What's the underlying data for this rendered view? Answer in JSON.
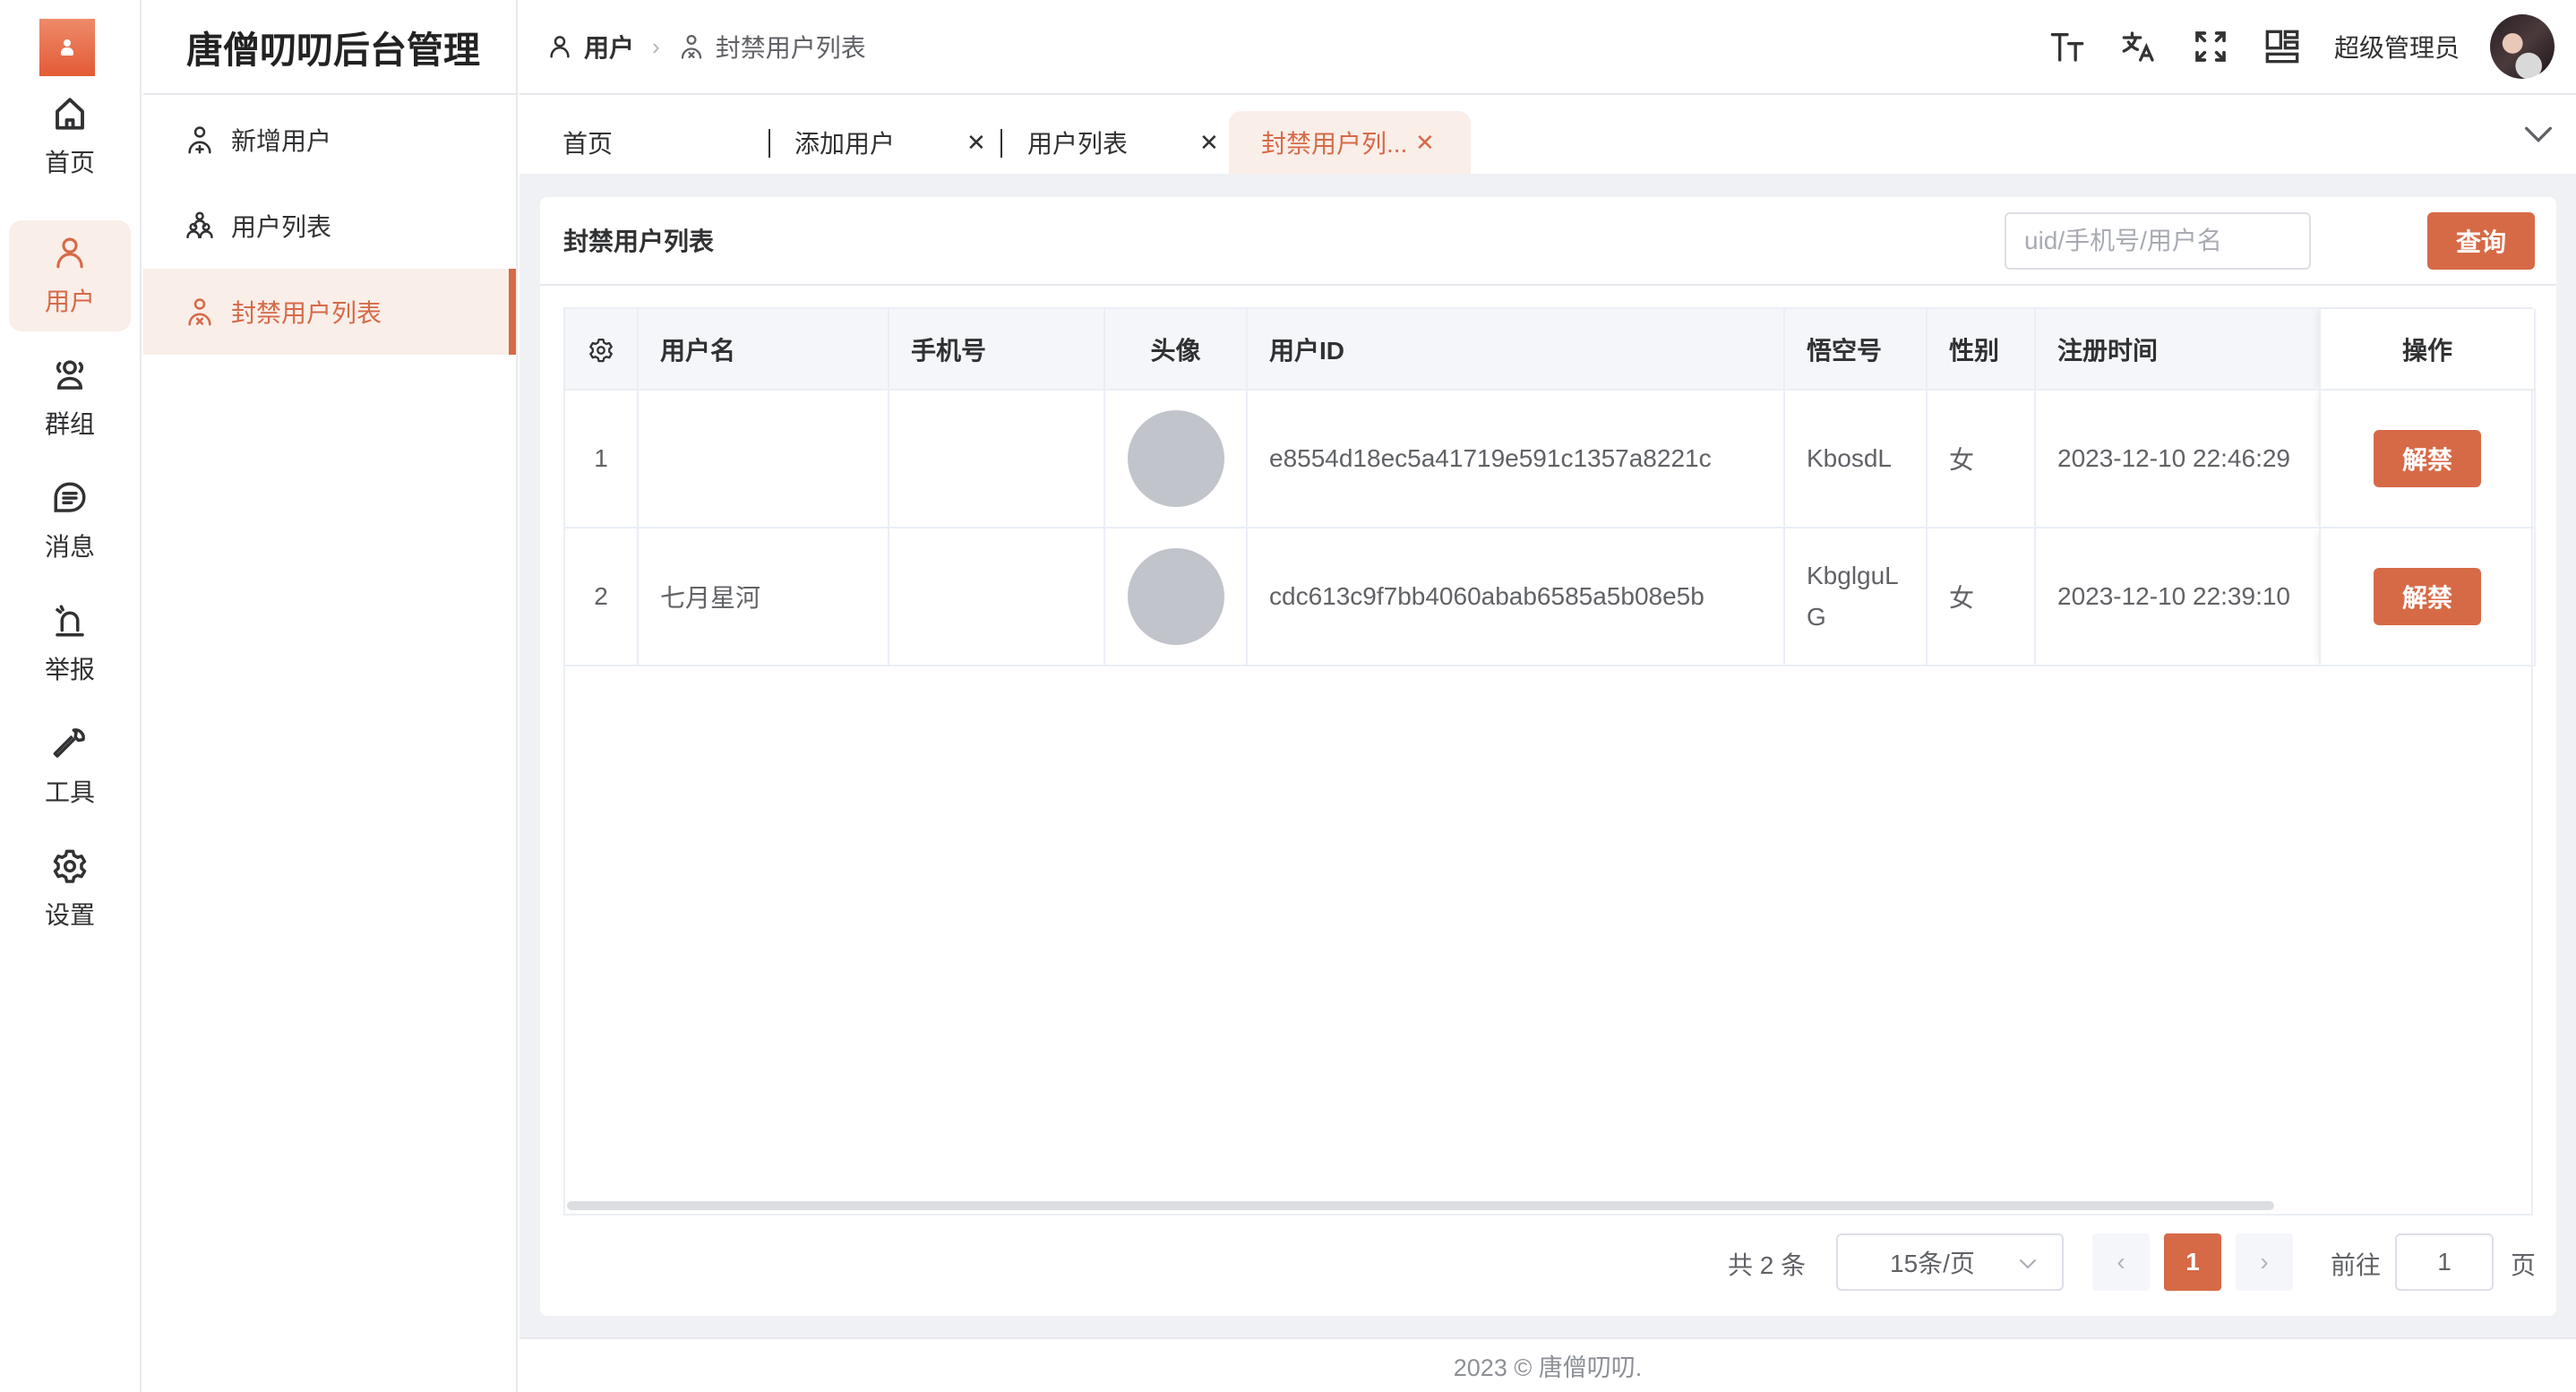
{
  "app": {
    "title": "唐僧叨叨后台管理"
  },
  "rail": {
    "items": [
      {
        "label": "首页",
        "icon": "home-icon"
      },
      {
        "label": "用户",
        "icon": "user-icon",
        "active": true
      },
      {
        "label": "群组",
        "icon": "group-icon"
      },
      {
        "label": "消息",
        "icon": "message-icon"
      },
      {
        "label": "举报",
        "icon": "alarm-icon"
      },
      {
        "label": "工具",
        "icon": "wrench-icon"
      },
      {
        "label": "设置",
        "icon": "gear-icon"
      }
    ]
  },
  "submenu": {
    "items": [
      {
        "label": "新增用户",
        "icon": "user-add-icon"
      },
      {
        "label": "用户列表",
        "icon": "users-icon"
      },
      {
        "label": "封禁用户列表",
        "icon": "user-banned-icon",
        "active": true
      }
    ]
  },
  "breadcrumb": {
    "parent": "用户",
    "current": "封禁用户列表"
  },
  "header": {
    "admin_name": "超级管理员"
  },
  "tabs": [
    {
      "label": "首页",
      "closable": false
    },
    {
      "label": "添加用户",
      "closable": true
    },
    {
      "label": "用户列表",
      "closable": true
    },
    {
      "label": "封禁用户列...",
      "closable": true,
      "active": true
    }
  ],
  "card": {
    "title": "封禁用户列表",
    "search_placeholder": "uid/手机号/用户名",
    "search_value": "",
    "query_label": "查询"
  },
  "table": {
    "columns": [
      "",
      "用户名",
      "手机号",
      "头像",
      "用户ID",
      "悟空号",
      "性别",
      "注册时间",
      "操作"
    ],
    "rows": [
      {
        "index": "1",
        "username": "",
        "phone": "",
        "user_id": "e8554d18ec5a41719e591c1357a8221c",
        "wukong_id": "KbosdL",
        "gender": "女",
        "registered": "2023-12-10 22:46:29",
        "action": "解禁"
      },
      {
        "index": "2",
        "username": "七月星河",
        "phone": "",
        "user_id": "cdc613c9f7bb4060abab6585a5b08e5b",
        "wukong_id": "KbglguLG",
        "gender": "女",
        "registered": "2023-12-10 22:39:10",
        "action": "解禁"
      }
    ]
  },
  "pagination": {
    "total_label": "共 2 条",
    "page_size": "15条/页",
    "current_page": "1",
    "prev": "‹",
    "next": "›",
    "goto_label": "前往",
    "goto_value": "1",
    "goto_suffix": "页"
  },
  "footer": {
    "text": "2023 © 唐僧叨叨."
  },
  "colors": {
    "accent": "#d66a47",
    "accent_light": "#faeee9"
  }
}
